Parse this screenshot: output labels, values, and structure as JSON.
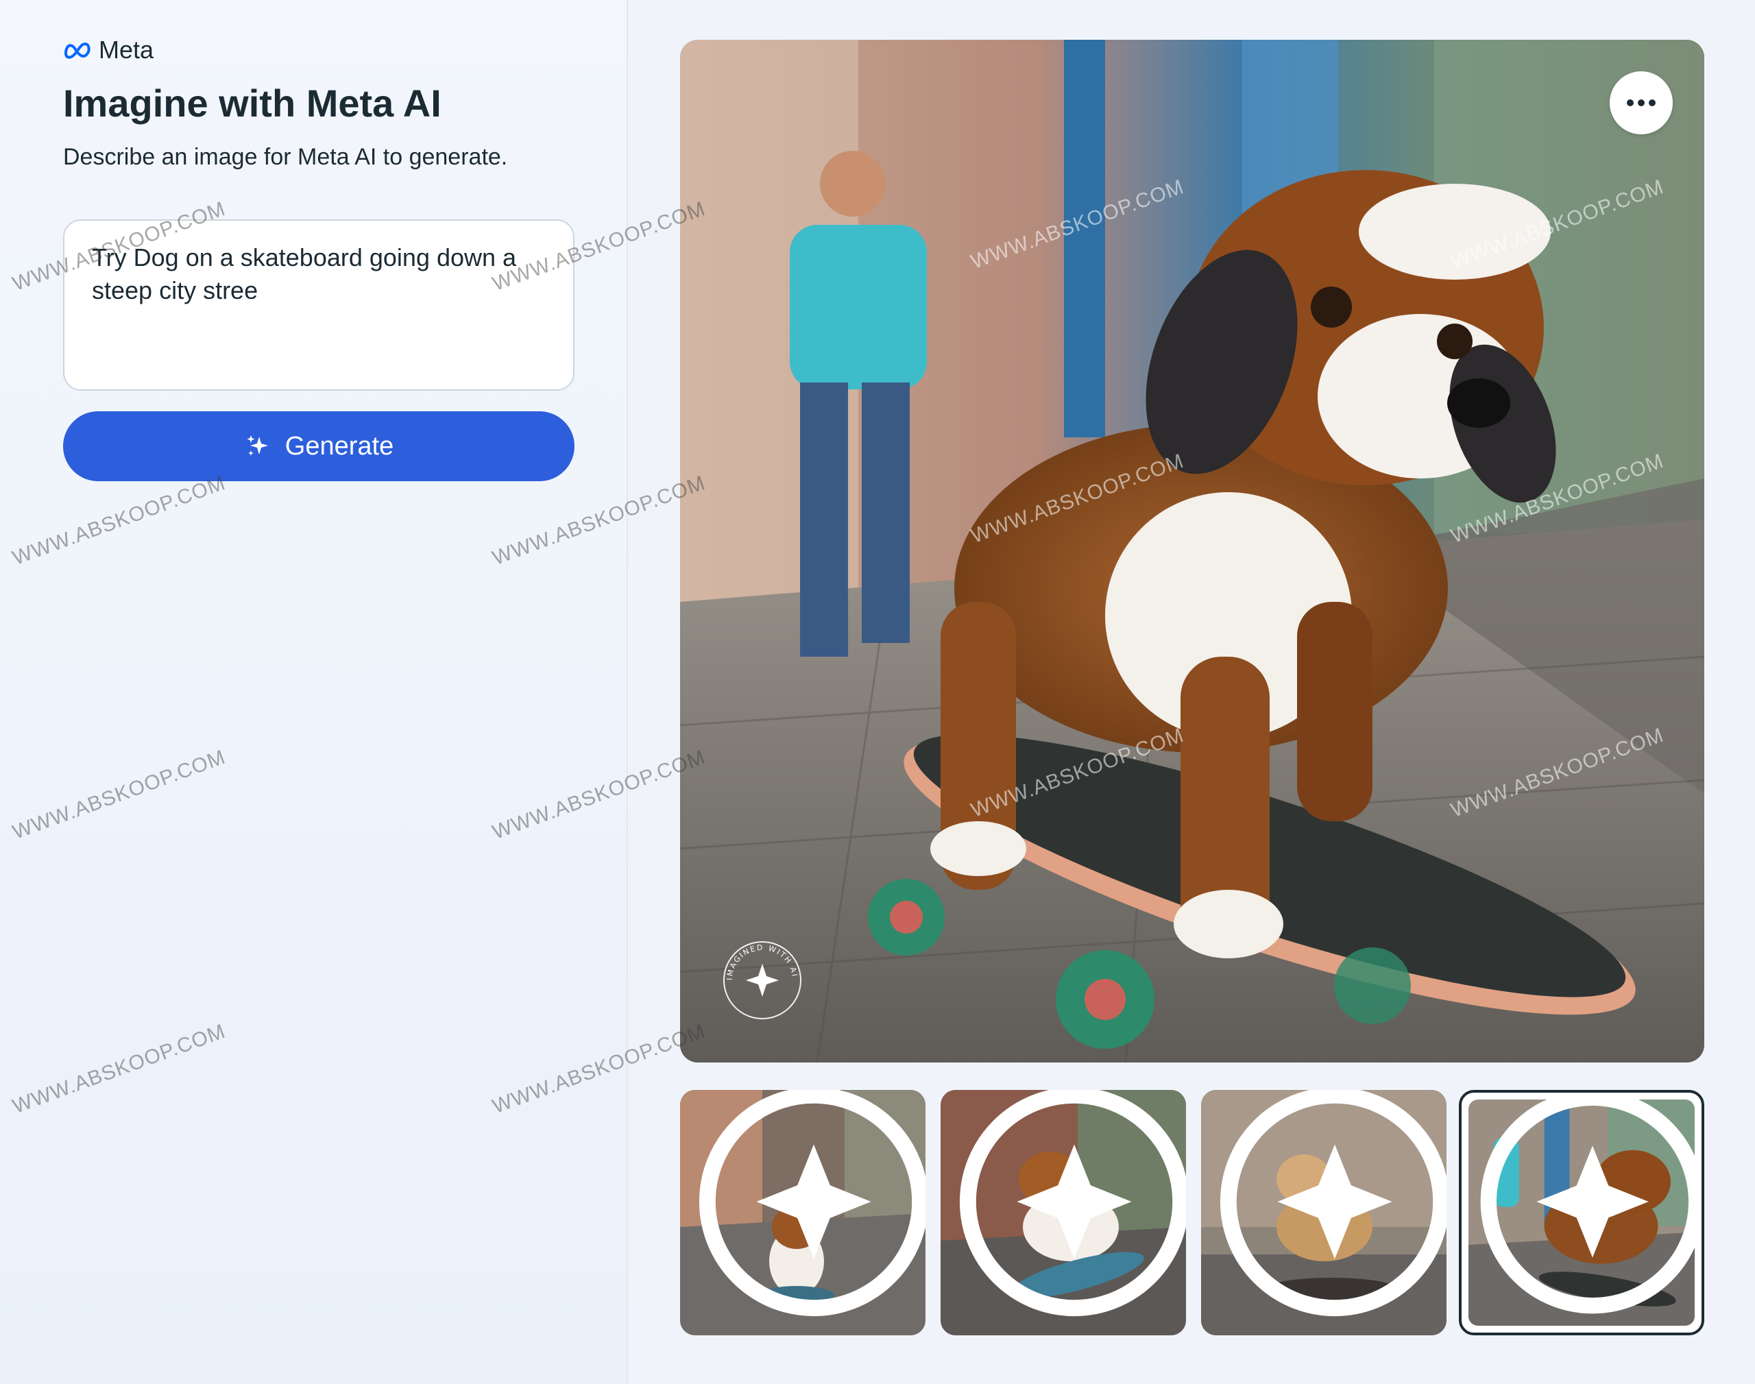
{
  "brand": {
    "name": "Meta",
    "icon": "meta-logo-icon"
  },
  "header": {
    "title": "Imagine with Meta AI",
    "subtitle": "Describe an image for Meta AI to generate."
  },
  "prompt": {
    "value": "Try Dog on a skateboard going down a steep city stree"
  },
  "generate_button": {
    "label": "Generate",
    "icon": "sparkle-icon"
  },
  "main_image": {
    "description_icon": "generated-image",
    "badge": "IMAGINED WITH AI",
    "more_icon": "more-options-icon"
  },
  "thumbnails": [
    {
      "name": "thumbnail-1",
      "selected": false
    },
    {
      "name": "thumbnail-2",
      "selected": false
    },
    {
      "name": "thumbnail-3",
      "selected": false
    },
    {
      "name": "thumbnail-4",
      "selected": true
    }
  ],
  "watermark": "WWW.ABSKOOP.COM",
  "colors": {
    "accent": "#2d5fdc",
    "text": "#1c2b33",
    "background": "#f0f4fa"
  }
}
